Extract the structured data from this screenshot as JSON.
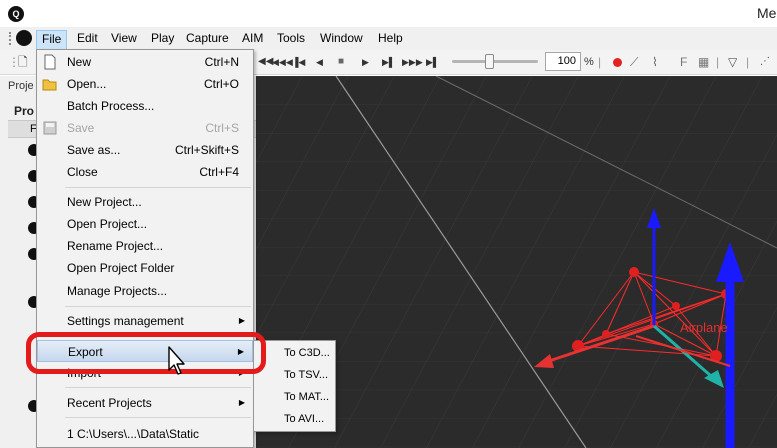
{
  "window": {
    "title": "Me"
  },
  "menubar": {
    "items": [
      {
        "id": "file",
        "label": "File"
      },
      {
        "id": "edit",
        "label": "Edit"
      },
      {
        "id": "view",
        "label": "View"
      },
      {
        "id": "play",
        "label": "Play"
      },
      {
        "id": "capture",
        "label": "Capture"
      },
      {
        "id": "aim",
        "label": "AIM"
      },
      {
        "id": "tools",
        "label": "Tools"
      },
      {
        "id": "window",
        "label": "Window"
      },
      {
        "id": "help",
        "label": "Help"
      }
    ]
  },
  "toolbar": {
    "zoom_value": "100",
    "zoom_unit": "%",
    "zoom_level_percent": 45,
    "f_label": "F"
  },
  "left_panel": {
    "tab_label": "Proje",
    "header_label": "Pro",
    "column_label": "F"
  },
  "file_menu": {
    "new": {
      "label": "New",
      "shortcut": "Ctrl+N"
    },
    "open": {
      "label": "Open...",
      "shortcut": "Ctrl+O"
    },
    "batch_process": {
      "label": "Batch Process..."
    },
    "save": {
      "label": "Save",
      "shortcut": "Ctrl+S",
      "disabled": true
    },
    "save_as": {
      "label": "Save as...",
      "shortcut": "Ctrl+Skift+S"
    },
    "close": {
      "label": "Close",
      "shortcut": "Ctrl+F4"
    },
    "new_project": {
      "label": "New Project..."
    },
    "open_project": {
      "label": "Open Project..."
    },
    "rename_project": {
      "label": "Rename Project..."
    },
    "open_project_folder": {
      "label": "Open Project Folder"
    },
    "manage_projects": {
      "label": "Manage Projects..."
    },
    "settings_management": {
      "label": "Settings management"
    },
    "export": {
      "label": "Export"
    },
    "import": {
      "label": "Import"
    },
    "recent_projects": {
      "label": "Recent Projects"
    },
    "recent_1": {
      "label": "1 C:\\Users\\...\\Data\\Static"
    }
  },
  "export_submenu": {
    "items": [
      {
        "id": "c3d",
        "label": "To C3D..."
      },
      {
        "id": "tsv",
        "label": "To TSV..."
      },
      {
        "id": "mat",
        "label": "To MAT..."
      },
      {
        "id": "avi",
        "label": "To AVI..."
      }
    ]
  },
  "viewport": {
    "model_label": "Airplane",
    "colors": {
      "background": "#2b2b2b",
      "grid": "#4a4a4a",
      "markers": "#ff2a2a",
      "axis_x": "#e63232",
      "axis_y": "#1a1aff",
      "axis_z": "#1fb3a8"
    }
  },
  "colors": {
    "highlight": "#e31b1b",
    "menu_selected": "#cce4f7"
  }
}
